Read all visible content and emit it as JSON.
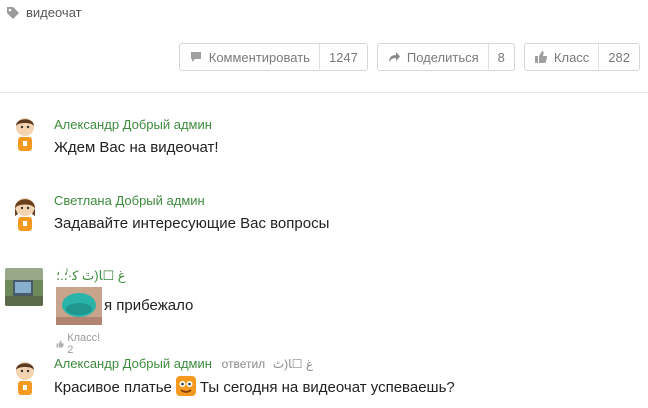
{
  "tag": {
    "icon": "tag-icon",
    "text": "видеочат"
  },
  "actions": [
    {
      "icon": "speech-bubble-icon",
      "label": "Комментировать",
      "count": "1247"
    },
    {
      "icon": "share-arrow-icon",
      "label": "Поделиться",
      "count": "8"
    },
    {
      "icon": "thumbs-up-icon",
      "label": "Класс",
      "count": "282"
    }
  ],
  "comments": [
    {
      "author": "Александр Добрый админ",
      "text": "Ждем Вас на видеочат!"
    },
    {
      "author": "Светлана Добрый админ",
      "text": "Задавайте интересующие Вас вопросы"
    },
    {
      "author": "ﻍ ☐ﺎ(ﭢ ﻛ·؛ٰ.؛",
      "text": "я прибежало",
      "likes": "Класс! 2"
    },
    {
      "author": "Александр Добрый админ",
      "replied": "ответил",
      "reply_to": "ﻍ ☐ﺎ(ﭢ",
      "text_before": "Красивое платье",
      "text_after": "Ты сегодня на видеочат успеваешь?"
    }
  ],
  "colors": {
    "author": "#3d8b3d",
    "accent_orange": "#f59a1f"
  }
}
